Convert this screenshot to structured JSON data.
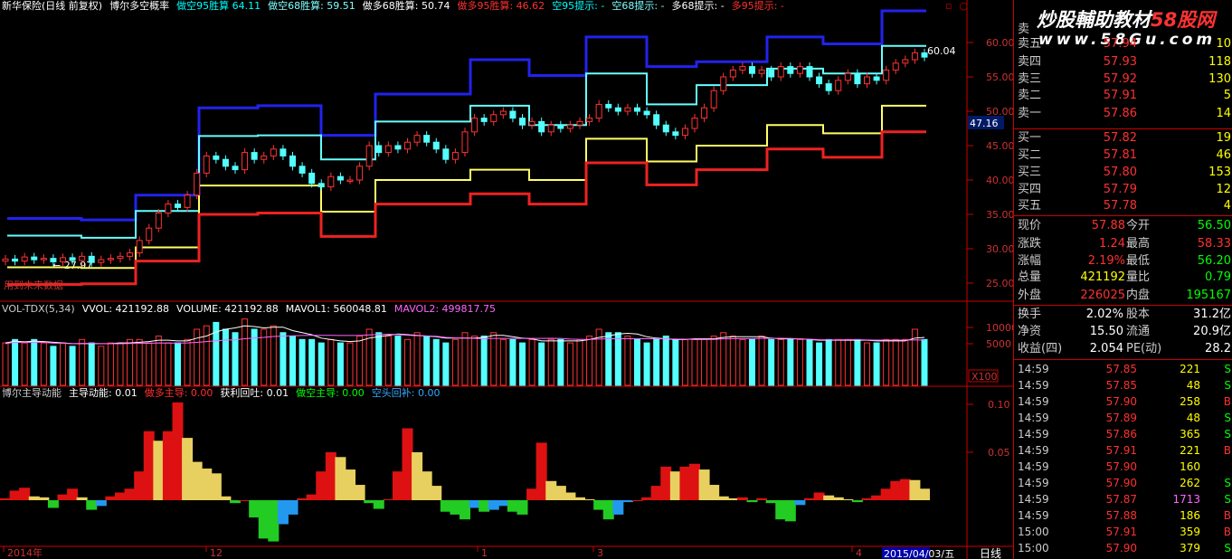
{
  "window": {
    "title": "新华保险(日线 前复权)",
    "corner_icons": [
      "window-restore-icon",
      "close-icon"
    ]
  },
  "indicator_header": {
    "name": "博尔多空概率",
    "items": [
      {
        "label": "做空95胜算",
        "value": "64.11",
        "color": "#00ffff"
      },
      {
        "label": "做空68胜算:",
        "value": "59.51",
        "color": "#80ffff"
      },
      {
        "label": "做多68胜算:",
        "value": "50.74",
        "color": "#ffffff"
      },
      {
        "label": "做多95胜算:",
        "value": "46.62",
        "color": "#ff3030"
      },
      {
        "label": "空95提示:",
        "value": "-",
        "color": "#00ffff"
      },
      {
        "label": "空68提示:",
        "value": "-",
        "color": "#80ffff"
      },
      {
        "label": "多68提示:",
        "value": "-",
        "color": "#ffffff"
      },
      {
        "label": "多95提示:",
        "value": "-",
        "color": "#ff3030"
      }
    ]
  },
  "price_axis": {
    "ticks": [
      "60.00",
      "55.00",
      "50.00",
      "45.00",
      "40.00",
      "35.00",
      "30.00",
      "25.00"
    ],
    "current": "47.16",
    "high_label": "60.04",
    "low_label": "27.97"
  },
  "price_note": "用到未来数据",
  "volume_header": {
    "items": [
      {
        "label": "VOL-TDX(5,34)",
        "value": "",
        "color": "#cccccc"
      },
      {
        "label": "VVOL:",
        "value": "421192.88",
        "color": "#ffffff"
      },
      {
        "label": "VOLUME:",
        "value": "421192.88",
        "color": "#ffffff"
      },
      {
        "label": "MAVOL1:",
        "value": "560048.81",
        "color": "#ffffff"
      },
      {
        "label": "MAVOL2:",
        "value": "499817.75",
        "color": "#ff66ff"
      }
    ]
  },
  "volume_axis": {
    "ticks": [
      "10000",
      "5000"
    ],
    "unit": "X100"
  },
  "macd_header": {
    "items": [
      {
        "label": "博尔主导动能",
        "value": "",
        "color": "#cccccc"
      },
      {
        "label": "主导动能:",
        "value": "0.01",
        "color": "#ffffff"
      },
      {
        "label": "做多主导:",
        "value": "0.00",
        "color": "#ff3030"
      },
      {
        "label": "获利回吐:",
        "value": "0.01",
        "color": "#ffffff"
      },
      {
        "label": "做空主导:",
        "value": "0.00",
        "color": "#00ff00"
      },
      {
        "label": "空头回补:",
        "value": "0.00",
        "color": "#33aaff"
      }
    ]
  },
  "macd_axis": {
    "ticks": [
      "0.10",
      "0.05"
    ]
  },
  "time_axis": {
    "labels": [
      "2014年",
      "12",
      "1",
      "3",
      "4"
    ],
    "current_date": "2015/04/03/五",
    "period": "日线"
  },
  "watermark": {
    "line1": "炒股輔助教材",
    "line1b": "58股网",
    "line2": "www.58Gu.com"
  },
  "order_book": {
    "sell_header": "卖",
    "sell": [
      {
        "label": "卖五",
        "price": "57.94",
        "vol": "10"
      },
      {
        "label": "卖四",
        "price": "57.93",
        "vol": "118"
      },
      {
        "label": "卖三",
        "price": "57.92",
        "vol": "130"
      },
      {
        "label": "卖二",
        "price": "57.91",
        "vol": "5"
      },
      {
        "label": "卖一",
        "price": "57.86",
        "vol": "14"
      }
    ],
    "buy": [
      {
        "label": "买一",
        "price": "57.82",
        "vol": "19"
      },
      {
        "label": "买二",
        "price": "57.81",
        "vol": "46"
      },
      {
        "label": "买三",
        "price": "57.80",
        "vol": "153"
      },
      {
        "label": "买四",
        "price": "57.79",
        "vol": "12"
      },
      {
        "label": "买五",
        "price": "57.78",
        "vol": "4"
      }
    ]
  },
  "quote": [
    {
      "l1": "现价",
      "v1": "57.88",
      "c1": "#ff3030",
      "l2": "今开",
      "v2": "56.50",
      "c2": "#00ff00"
    },
    {
      "l1": "涨跌",
      "v1": "1.24",
      "c1": "#ff3030",
      "l2": "最高",
      "v2": "58.33",
      "c2": "#ff3030"
    },
    {
      "l1": "涨幅",
      "v1": "2.19%",
      "c1": "#ff3030",
      "l2": "最低",
      "v2": "56.20",
      "c2": "#00ff00"
    },
    {
      "l1": "总量",
      "v1": "421192",
      "c1": "#ffff00",
      "l2": "量比",
      "v2": "0.79",
      "c2": "#00ff00"
    },
    {
      "l1": "外盘",
      "v1": "226025",
      "c1": "#ff3030",
      "l2": "内盘",
      "v2": "195167",
      "c2": "#00ff00"
    }
  ],
  "stats": [
    {
      "l1": "换手",
      "v1": "2.02%",
      "l2": "股本",
      "v2": "31.2亿"
    },
    {
      "l1": "净资",
      "v1": "15.50",
      "l2": "流通",
      "v2": "20.9亿"
    },
    {
      "l1": "收益(四)",
      "v1": "2.054",
      "l2": "PE(动)",
      "v2": "28.2"
    }
  ],
  "ticks": [
    {
      "time": "14:59",
      "price": "57.85",
      "vol": "221",
      "side": "S"
    },
    {
      "time": "14:59",
      "price": "57.85",
      "vol": "48",
      "side": "S"
    },
    {
      "time": "14:59",
      "price": "57.90",
      "vol": "258",
      "side": "B"
    },
    {
      "time": "14:59",
      "price": "57.89",
      "vol": "48",
      "side": "S"
    },
    {
      "time": "14:59",
      "price": "57.86",
      "vol": "365",
      "side": "S"
    },
    {
      "time": "14:59",
      "price": "57.91",
      "vol": "221",
      "side": "B"
    },
    {
      "time": "14:59",
      "price": "57.90",
      "vol": "160",
      "side": ""
    },
    {
      "time": "14:59",
      "price": "57.90",
      "vol": "262",
      "side": "S"
    },
    {
      "time": "14:59",
      "price": "57.87",
      "vol": "1713",
      "side": "S"
    },
    {
      "time": "14:59",
      "price": "57.88",
      "vol": "186",
      "side": "B"
    },
    {
      "time": "15:00",
      "price": "57.91",
      "vol": "359",
      "side": "B"
    },
    {
      "time": "15:00",
      "price": "57.90",
      "vol": "379",
      "side": "S"
    }
  ]
}
